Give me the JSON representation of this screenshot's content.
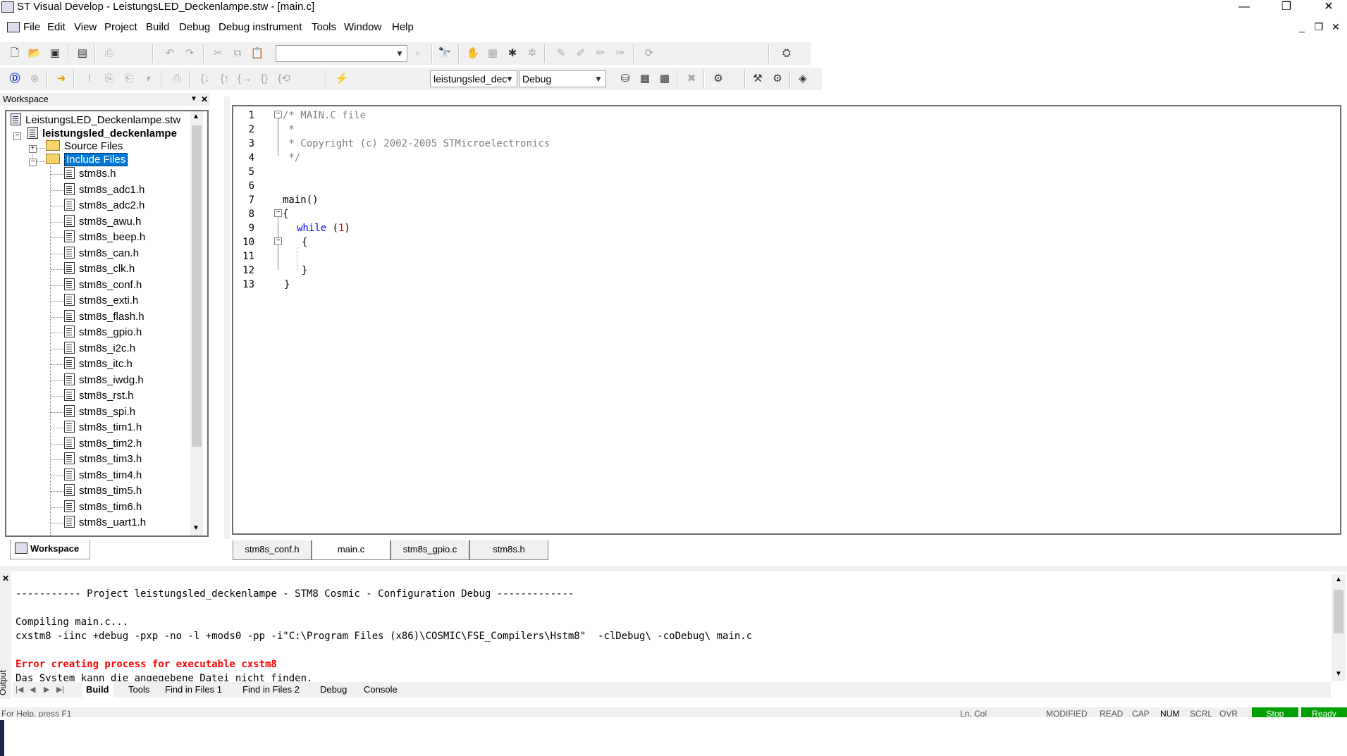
{
  "window": {
    "title": "ST Visual Develop - LeistungsLED_Deckenlampe.stw - [main.c]",
    "minimize": "—",
    "restore": "❐",
    "close": "✕"
  },
  "menu": [
    "File",
    "Edit",
    "View",
    "Project",
    "Build",
    "Debug",
    "Debug instrument",
    "Tools",
    "Window",
    "Help"
  ],
  "mdi_controls": [
    "_",
    "❐",
    "✕"
  ],
  "toolbar": {
    "search_value": "",
    "project_select": "leistungsled_dec",
    "config_select": "Debug"
  },
  "workspace": {
    "header": "Workspace",
    "workspace_file": "LeistungsLED_Deckenlampe.stw",
    "project": "leistungsled_deckenlampe",
    "source_folder": "Source Files",
    "include_folder": "Include Files",
    "files": [
      "stm8s.h",
      "stm8s_adc1.h",
      "stm8s_adc2.h",
      "stm8s_awu.h",
      "stm8s_beep.h",
      "stm8s_can.h",
      "stm8s_clk.h",
      "stm8s_conf.h",
      "stm8s_exti.h",
      "stm8s_flash.h",
      "stm8s_gpio.h",
      "stm8s_i2c.h",
      "stm8s_itc.h",
      "stm8s_iwdg.h",
      "stm8s_rst.h",
      "stm8s_spi.h",
      "stm8s_tim1.h",
      "stm8s_tim2.h",
      "stm8s_tim3.h",
      "stm8s_tim4.h",
      "stm8s_tim5.h",
      "stm8s_tim6.h",
      "stm8s_uart1.h"
    ],
    "tab": "Workspace"
  },
  "editor": {
    "line_numbers": [
      "1",
      "2",
      "3",
      "4",
      "5",
      "6",
      "7",
      "8",
      "9",
      "10",
      "11",
      "12",
      "13"
    ],
    "code": {
      "l1": "/* MAIN.C file",
      "l2": " *",
      "l3": " * Copyright (c) 2002-2005 STMicroelectronics",
      "l4": " */",
      "l7": "main()",
      "l8": "{",
      "l9_kw": "while",
      "l9_open": " (",
      "l9_num": "1",
      "l9_close": ")",
      "l10": "  {",
      "l12": "  }",
      "l13": "}"
    },
    "tabs": [
      "stm8s_conf.h",
      "main.c",
      "stm8s_gpio.c",
      "stm8s.h"
    ],
    "active_tab": "main.c"
  },
  "output": {
    "label": "Output",
    "lines": {
      "header": "----------- Project leistungsled_deckenlampe - STM8 Cosmic - Configuration Debug -------------",
      "compiling": "Compiling main.c...",
      "command": "cxstm8 -iinc +debug -pxp -no -l +mods0 -pp -i\"C:\\Program Files (x86)\\COSMIC\\FSE_Compilers\\Hstm8\"  -clDebug\\ -coDebug\\ main.c",
      "error": "Error creating process for executable cxstm8",
      "detail": "Das System kann die angegebene Datei nicht finden."
    },
    "tabs": [
      "Build",
      "Tools",
      "Find in Files 1",
      "Find in Files 2",
      "Debug",
      "Console"
    ],
    "active_tab": "Build"
  },
  "status": {
    "help": "For Help, press F1",
    "position": "Ln, Col",
    "indicators": [
      "MODIFIED",
      "READ",
      "CAP",
      "NUM",
      "SCRL",
      "OVR"
    ],
    "state1": "Stop",
    "state2": "Ready"
  },
  "colors": {
    "selection": "#0078d7",
    "keyword": "#0000ff",
    "comment": "#808080",
    "error": "#ff0000",
    "status_green": "#00a000"
  }
}
